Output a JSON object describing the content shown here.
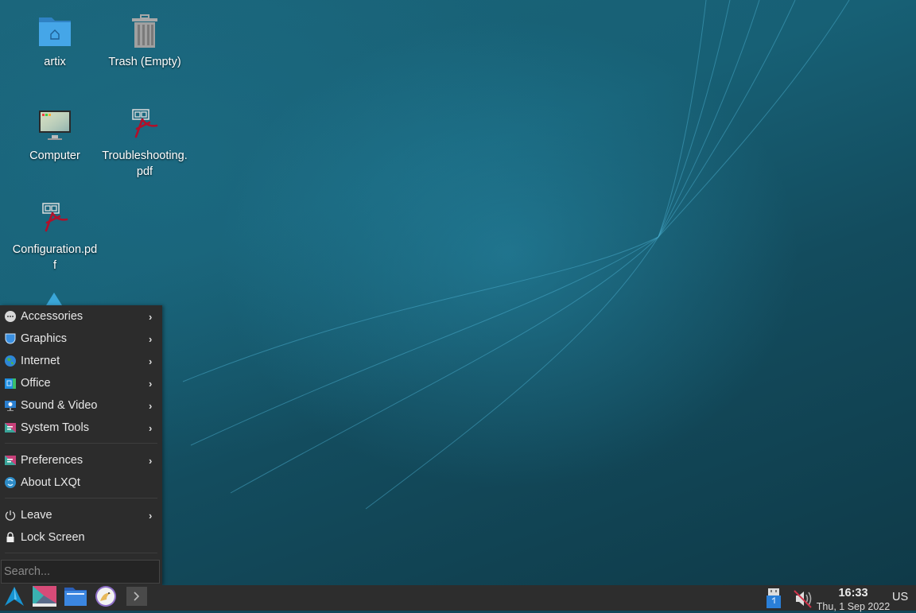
{
  "desktop": {
    "icons": [
      {
        "label": "artix",
        "icon": "home-folder-icon"
      },
      {
        "label": "Trash (Empty)",
        "icon": "trash-icon"
      },
      {
        "label": "Computer",
        "icon": "computer-icon"
      },
      {
        "label": "Troubleshooting.pdf",
        "icon": "pdf-icon"
      },
      {
        "label": "Configuration.pdf",
        "icon": "pdf-icon"
      }
    ]
  },
  "menu": {
    "categories": [
      {
        "label": "Accessories",
        "icon": "accessories-icon",
        "has_submenu": true
      },
      {
        "label": "Graphics",
        "icon": "graphics-icon",
        "has_submenu": true
      },
      {
        "label": "Internet",
        "icon": "internet-globe-icon",
        "has_submenu": true
      },
      {
        "label": "Office",
        "icon": "office-icon",
        "has_submenu": true
      },
      {
        "label": "Sound & Video",
        "icon": "sound-video-icon",
        "has_submenu": true
      },
      {
        "label": "System Tools",
        "icon": "system-tools-icon",
        "has_submenu": true
      }
    ],
    "settings": [
      {
        "label": "Preferences",
        "icon": "preferences-icon",
        "has_submenu": true
      },
      {
        "label": "About LXQt",
        "icon": "lxqt-logo-icon",
        "has_submenu": false
      }
    ],
    "session": [
      {
        "label": "Leave",
        "icon": "power-icon",
        "has_submenu": true
      },
      {
        "label": "Lock Screen",
        "icon": "lock-icon",
        "has_submenu": false
      }
    ],
    "search_placeholder": "Search..."
  },
  "taskbar": {
    "launchers": [
      {
        "name": "artix-menu-button",
        "icon": "artix-logo-icon"
      },
      {
        "name": "show-desktop-button",
        "icon": "desktop-icon"
      },
      {
        "name": "file-manager-button",
        "icon": "folder-icon"
      },
      {
        "name": "browser-button",
        "icon": "falkon-browser-icon"
      },
      {
        "name": "terminal-button",
        "icon": "terminal-icon"
      }
    ],
    "tray": {
      "usb_icon": "removable-media-icon",
      "volume_icon": "volume-muted-icon",
      "clock_time": "16:33",
      "clock_date": "Thu, 1 Sep 2022",
      "keyboard_layout": "US"
    }
  },
  "colors": {
    "menu_bg": "#2c2c2c",
    "taskbar_bg": "#2d2d2d",
    "accent": "#1793d1",
    "pdf_red": "#b0102a"
  }
}
